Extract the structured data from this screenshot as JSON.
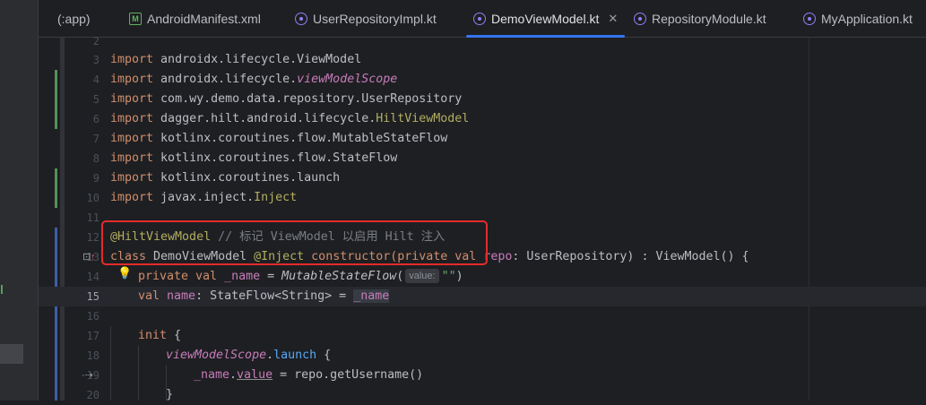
{
  "tabs": [
    {
      "label": "(:app)",
      "icon": "none"
    },
    {
      "label": "AndroidManifest.xml",
      "icon": "manifest-icon"
    },
    {
      "label": "UserRepositoryImpl.kt",
      "icon": "kotlin-file-icon"
    },
    {
      "label": "DemoViewModel.kt",
      "icon": "kotlin-file-icon",
      "close": "✕"
    },
    {
      "label": "RepositoryModule.kt",
      "icon": "kotlin-file-icon"
    },
    {
      "label": "MyApplication.kt",
      "icon": "kotlin-file-icon"
    }
  ],
  "line_numbers": [
    "2",
    "3",
    "4",
    "5",
    "6",
    "7",
    "8",
    "9",
    "10",
    "11",
    "12",
    "13",
    "14",
    "15",
    "16",
    "17",
    "18",
    "19",
    "20"
  ],
  "code": {
    "l3": {
      "kw": "import",
      "rest": " androidx.lifecycle.ViewModel"
    },
    "l4": {
      "kw": "import",
      "pre": " androidx.lifecycle.",
      "ital": "viewModelScope"
    },
    "l5": {
      "kw": "import",
      "rest": " com.wy.demo.data.repository.UserRepository"
    },
    "l6": {
      "kw": "import",
      "pre": " dagger.hilt.android.lifecycle.",
      "ann": "HiltViewModel"
    },
    "l7": {
      "kw": "import",
      "rest": " kotlinx.coroutines.flow.MutableStateFlow"
    },
    "l8": {
      "kw": "import",
      "rest": " kotlinx.coroutines.flow.StateFlow"
    },
    "l9": {
      "kw": "import",
      "rest": " kotlinx.coroutines.launch"
    },
    "l10": {
      "kw": "import",
      "pre": " javax.inject.",
      "ann": "Inject"
    },
    "l12": {
      "ann": "@HiltViewModel",
      "cmt": " // 标记 ViewModel 以启用 Hilt 注入"
    },
    "l13": {
      "kw1": "class",
      "name": " DemoViewModel ",
      "ann": "@Inject",
      "kw2": " constructor(",
      "kw3": "private val",
      "param": " repo",
      "rest": ": UserRepository) : ViewModel() {"
    },
    "l14": {
      "kw": "private val",
      "prop": " _name",
      "eq": " = ",
      "fn": "MutableStateFlow",
      "open": "(",
      "hint": "value:",
      "str": "\"\"",
      "close": ")"
    },
    "l15": {
      "kw": "val",
      "prop": " name",
      "type": ": StateFlow<String> = ",
      "ref": "_name"
    },
    "l17": {
      "kw": "init",
      "rest": " {"
    },
    "l18": {
      "ital": "viewModelScope",
      "dot": ".",
      "fn": "launch",
      "rest": " {"
    },
    "l19": {
      "prop1": "_name",
      "dot": ".",
      "prop2": "value",
      "rest": " = repo.getUsername()"
    },
    "l20": {
      "rest": "}"
    }
  }
}
